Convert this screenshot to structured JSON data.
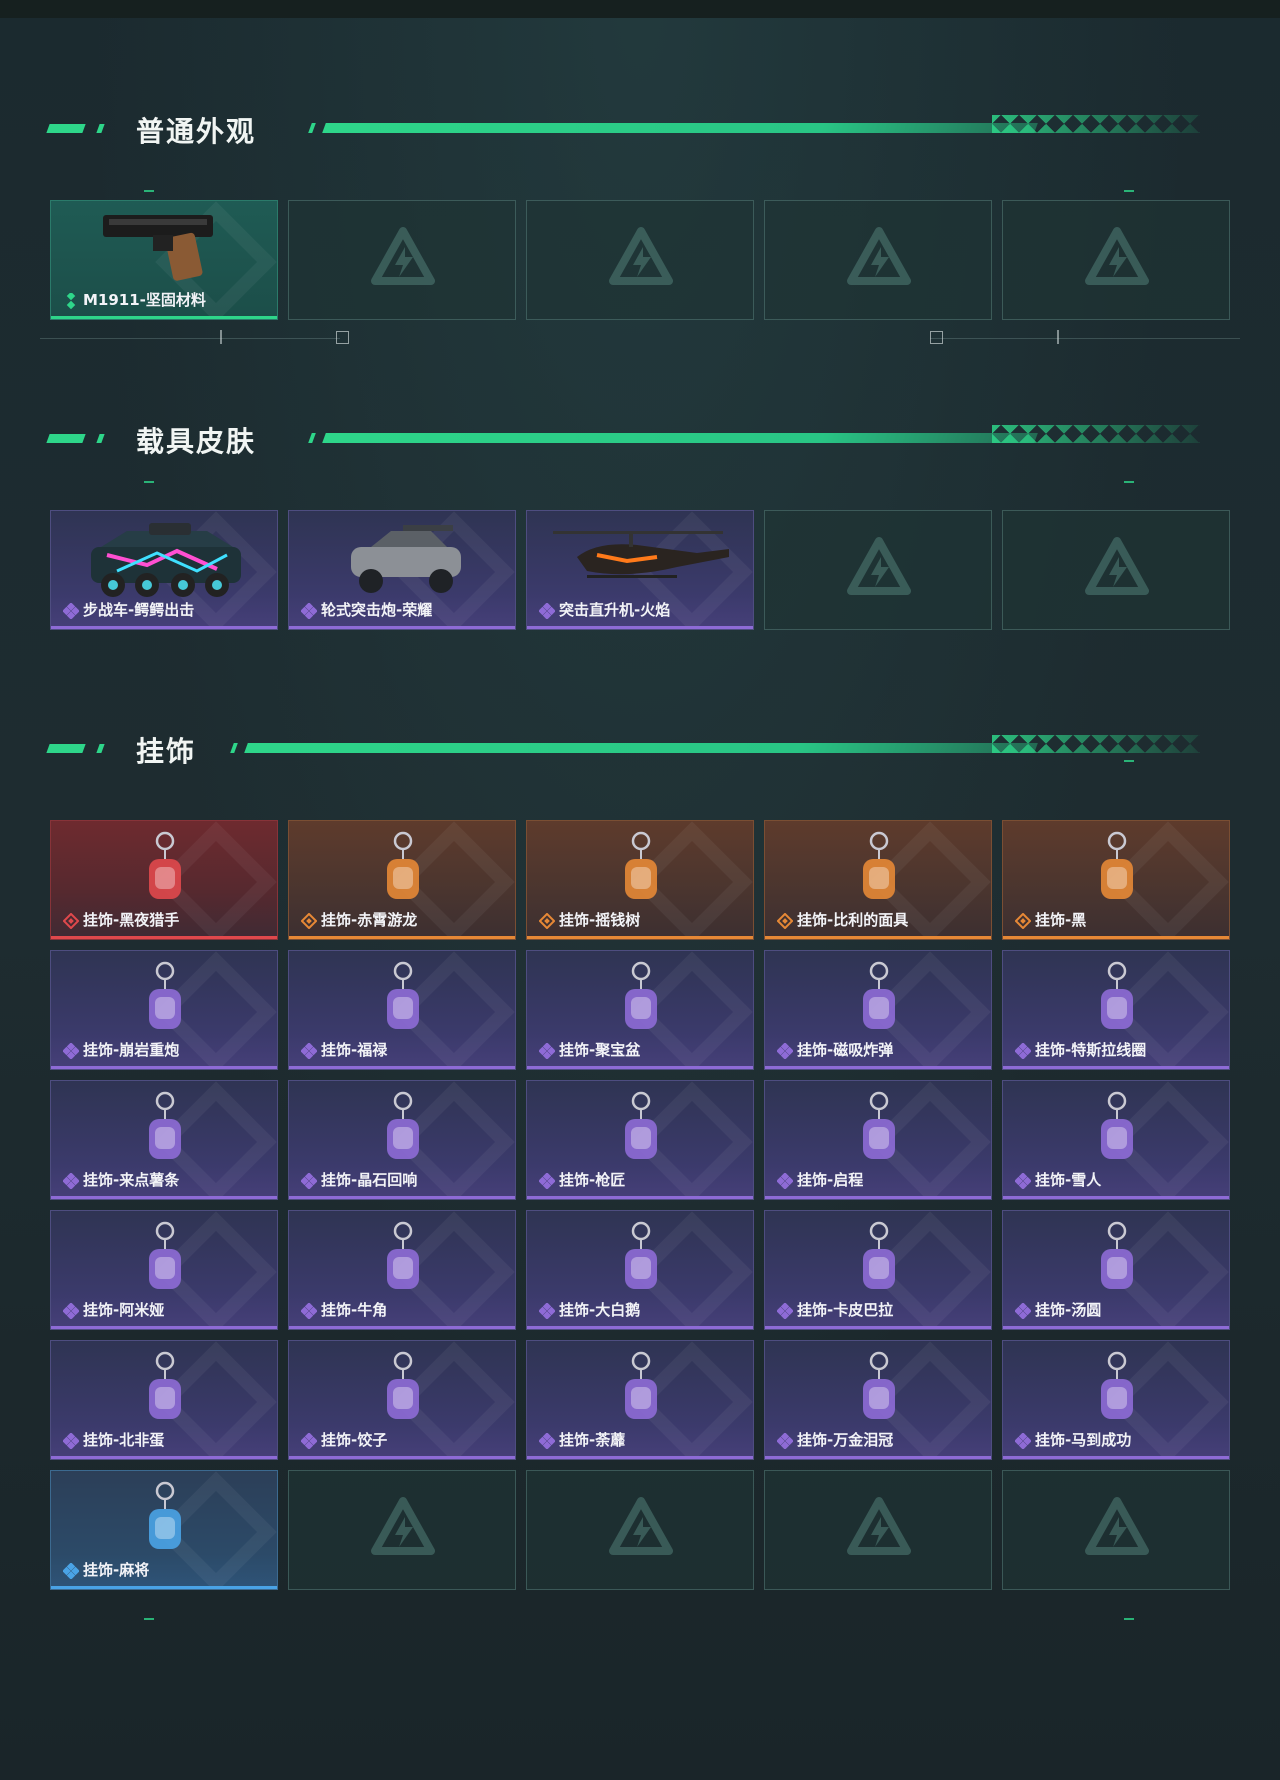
{
  "colors": {
    "accent": "#2ed68a",
    "rarity_green": "#2ed68a",
    "rarity_purple": "#8e6bd6",
    "rarity_red": "#e0484c",
    "rarity_orange": "#e68836",
    "rarity_blue": "#4aa3e6"
  },
  "sections": [
    {
      "title": "普通外观",
      "items": [
        {
          "label": "M1911-坚固材料",
          "rarity": "green",
          "icon": "pistol-icon"
        },
        {
          "empty": true
        },
        {
          "empty": true
        },
        {
          "empty": true
        },
        {
          "empty": true
        }
      ]
    },
    {
      "title": "载具皮肤",
      "items": [
        {
          "label": "步战车-鳄鳄出击",
          "rarity": "purple",
          "icon": "armored-vehicle-icon"
        },
        {
          "label": "轮式突击炮-荣耀",
          "rarity": "purple",
          "icon": "assault-vehicle-icon"
        },
        {
          "label": "突击直升机-火焰",
          "rarity": "purple",
          "icon": "helicopter-icon"
        },
        {
          "empty": true
        },
        {
          "empty": true
        }
      ]
    },
    {
      "title": "挂饰",
      "items": [
        {
          "label": "挂饰-黑夜猎手",
          "rarity": "red",
          "icon": "charm-icon"
        },
        {
          "label": "挂饰-赤霄游龙",
          "rarity": "orange",
          "icon": "charm-icon"
        },
        {
          "label": "挂饰-摇钱树",
          "rarity": "orange",
          "icon": "charm-icon"
        },
        {
          "label": "挂饰-比利的面具",
          "rarity": "orange",
          "icon": "charm-icon"
        },
        {
          "label": "挂饰-黑",
          "rarity": "orange",
          "icon": "charm-icon"
        },
        {
          "label": "挂饰-崩岩重炮",
          "rarity": "purple",
          "icon": "charm-icon"
        },
        {
          "label": "挂饰-福禄",
          "rarity": "purple",
          "icon": "charm-icon"
        },
        {
          "label": "挂饰-聚宝盆",
          "rarity": "purple",
          "icon": "charm-icon"
        },
        {
          "label": "挂饰-磁吸炸弹",
          "rarity": "purple",
          "icon": "charm-icon"
        },
        {
          "label": "挂饰-特斯拉线圈",
          "rarity": "purple",
          "icon": "charm-icon"
        },
        {
          "label": "挂饰-来点薯条",
          "rarity": "purple",
          "icon": "charm-icon"
        },
        {
          "label": "挂饰-晶石回响",
          "rarity": "purple",
          "icon": "charm-icon"
        },
        {
          "label": "挂饰-枪匠",
          "rarity": "purple",
          "icon": "charm-icon"
        },
        {
          "label": "挂饰-启程",
          "rarity": "purple",
          "icon": "charm-icon"
        },
        {
          "label": "挂饰-雪人",
          "rarity": "purple",
          "icon": "charm-icon"
        },
        {
          "label": "挂饰-阿米娅",
          "rarity": "purple",
          "icon": "charm-icon"
        },
        {
          "label": "挂饰-牛角",
          "rarity": "purple",
          "icon": "charm-icon"
        },
        {
          "label": "挂饰-大白鹅",
          "rarity": "purple",
          "icon": "charm-icon"
        },
        {
          "label": "挂饰-卡皮巴拉",
          "rarity": "purple",
          "icon": "charm-icon"
        },
        {
          "label": "挂饰-汤圆",
          "rarity": "purple",
          "icon": "charm-icon"
        },
        {
          "label": "挂饰-北非蛋",
          "rarity": "purple",
          "icon": "charm-icon"
        },
        {
          "label": "挂饰-饺子",
          "rarity": "purple",
          "icon": "charm-icon"
        },
        {
          "label": "挂饰-荼蘼",
          "rarity": "purple",
          "icon": "charm-icon"
        },
        {
          "label": "挂饰-万金泪冠",
          "rarity": "purple",
          "icon": "charm-icon"
        },
        {
          "label": "挂饰-马到成功",
          "rarity": "purple",
          "icon": "charm-icon"
        },
        {
          "label": "挂饰-麻将",
          "rarity": "blue",
          "icon": "charm-icon"
        },
        {
          "empty": true
        },
        {
          "empty": true
        },
        {
          "empty": true
        },
        {
          "empty": true
        }
      ]
    }
  ]
}
